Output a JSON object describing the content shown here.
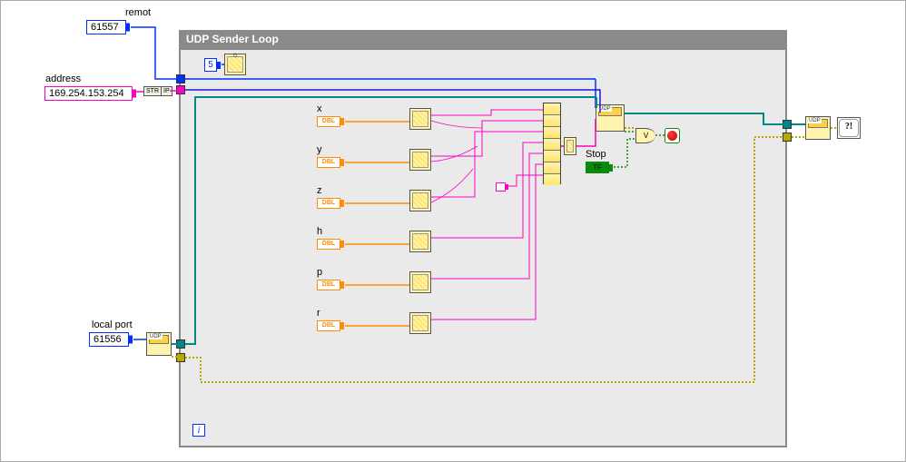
{
  "labels": {
    "remote_port": "remot",
    "remote_port_value": "61557",
    "address": "address",
    "address_value": "169.254.153.254",
    "local_port": "local port",
    "local_port_value": "61556",
    "loop_title": "UDP Sender Loop",
    "wait_const": "5",
    "iter_i": "i",
    "stop_label": "Stop",
    "dbl_tag": "DBL",
    "tf_tag": "TF",
    "str_tag": "STR",
    "ip_tag": "IP",
    "udp_tag": "UDP",
    "error_tag": "Error",
    "or_symbol": "V"
  },
  "channels": [
    {
      "name": "x"
    },
    {
      "name": "y"
    },
    {
      "name": "z"
    },
    {
      "name": "h"
    },
    {
      "name": "p"
    },
    {
      "name": "r"
    }
  ],
  "colors": {
    "int_wire": "#0030ff",
    "str_wire": "#ff00c0",
    "dbl_wire": "#ff8c00",
    "refnum_wire": "#008888",
    "bool_wire": "#0a8a0a",
    "err_wire": "#b8a800",
    "loop_grey": "#8a8a8a"
  }
}
